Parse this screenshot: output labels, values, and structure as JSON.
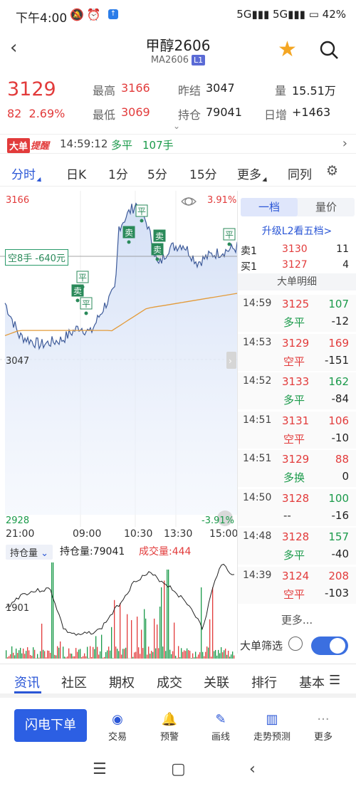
{
  "status": {
    "time": "下午4:00",
    "network": "5G",
    "network2": "5G",
    "battery": "42%"
  },
  "header": {
    "name": "甲醇2606",
    "code": "MA2606",
    "badge": "L1"
  },
  "quote": {
    "price": "3129",
    "change": "82",
    "change_pct": "2.69%",
    "high_label": "最高",
    "high": "3166",
    "low_label": "最低",
    "low": "3069",
    "prev_label": "昨结",
    "prev": "3047",
    "oi_label": "持仓",
    "oi": "79041",
    "vol_label": "量",
    "vol": "15.51万",
    "daily_label": "日增",
    "daily": "+1463"
  },
  "alert": {
    "badge": "大单",
    "badge2": "提醒",
    "time": "14:59:12",
    "action": "多平",
    "volume": "107手"
  },
  "tabs": [
    "分时",
    "日K",
    "1分",
    "5分",
    "15分",
    "更多",
    "同列"
  ],
  "chart": {
    "y_top": "3166",
    "y_top_pct": "3.91%",
    "y_mid": "3047",
    "y_bot": "2928",
    "y_bot_pct": "-3.91%",
    "x_labels": [
      "21:00",
      "09:00",
      "10:30",
      "13:30",
      "15:00"
    ],
    "position_label": "空8手 -640元",
    "marks": [
      "平",
      "卖",
      "平",
      "卖",
      "卖",
      "平",
      "平"
    ]
  },
  "panel": {
    "seg_on": "一档",
    "seg_off": "量价",
    "upgrade": "升级L2看五档>",
    "ask_label": "卖1",
    "ask_price": "3130",
    "ask_vol": "11",
    "bid_label": "买1",
    "bid_price": "3127",
    "bid_vol": "4",
    "header": "大单明细",
    "trades": [
      {
        "time": "14:59",
        "price": "3125",
        "vol": "107",
        "action": "多平",
        "diff": "-12"
      },
      {
        "time": "14:53",
        "price": "3129",
        "vol": "169",
        "action": "空平",
        "diff": "-151"
      },
      {
        "time": "14:52",
        "price": "3133",
        "vol": "162",
        "action": "多平",
        "diff": "-84"
      },
      {
        "time": "14:51",
        "price": "3131",
        "vol": "106",
        "action": "空平",
        "diff": "-10"
      },
      {
        "time": "14:51",
        "price": "3129",
        "vol": "88",
        "action": "多换",
        "diff": "0"
      },
      {
        "time": "14:50",
        "price": "3128",
        "vol": "100",
        "action": "--",
        "diff": "-16"
      },
      {
        "time": "14:48",
        "price": "3128",
        "vol": "157",
        "action": "多平",
        "diff": "-40"
      },
      {
        "time": "14:39",
        "price": "3124",
        "vol": "208",
        "action": "空平",
        "diff": "-103"
      }
    ],
    "more": "更多..."
  },
  "volume": {
    "selector": "持仓量",
    "oi_text": "持仓量:79041",
    "vol_text": "成交量:444",
    "y_label": "1901"
  },
  "filter": {
    "label": "大单筛选"
  },
  "bottom_tabs": [
    "资讯",
    "社区",
    "期权",
    "成交",
    "关联",
    "排行",
    "基本"
  ],
  "actions": {
    "flash": "闪电下单",
    "items": [
      {
        "label": "交易",
        "icon": "trade-icon"
      },
      {
        "label": "预警",
        "icon": "bell-icon"
      },
      {
        "label": "画线",
        "icon": "pen-icon"
      },
      {
        "label": "走势预测",
        "icon": "book-icon"
      },
      {
        "label": "更多",
        "icon": "more-icon"
      }
    ]
  },
  "colors": {
    "up": "#e23b3b",
    "down": "#1a9a4a",
    "accent": "#2a56d6",
    "avg_line": "#e39b3a",
    "price_line": "#3d5a99"
  }
}
